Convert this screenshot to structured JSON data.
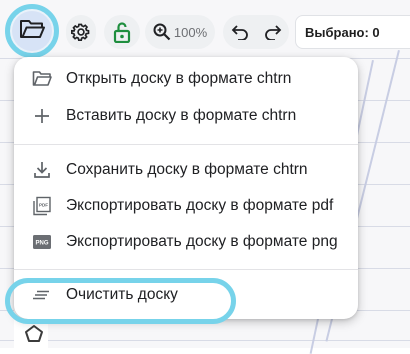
{
  "toolbar": {
    "open_icon": "folder-open-icon",
    "settings_icon": "gear-icon",
    "lock_icon": "lock-open-icon",
    "zoom_icon": "magnifier-plus-icon",
    "zoom_level": "100%",
    "undo_icon": "undo-icon",
    "redo_icon": "redo-icon",
    "selected_label": "Выбрано: 0"
  },
  "menu": {
    "items": [
      {
        "icon": "folder-open-icon",
        "label": "Открыть доску в формате chtrn"
      },
      {
        "icon": "plus-icon",
        "label": "Вставить доску в формате chtrn"
      },
      {
        "icon": "download-icon",
        "label": "Сохранить доску в формате chtrn"
      },
      {
        "icon": "pdf-file-icon",
        "label": "Экспортировать доску в формате pdf"
      },
      {
        "icon": "png-file-icon",
        "label": "Экспортировать доску в формате png"
      },
      {
        "icon": "clear-lines-icon",
        "label": "Очистить доску"
      }
    ]
  },
  "colors": {
    "highlight_ring": "#77d3ea",
    "lock_green": "#1e8e3e",
    "active_button": "#d7e3f6"
  }
}
